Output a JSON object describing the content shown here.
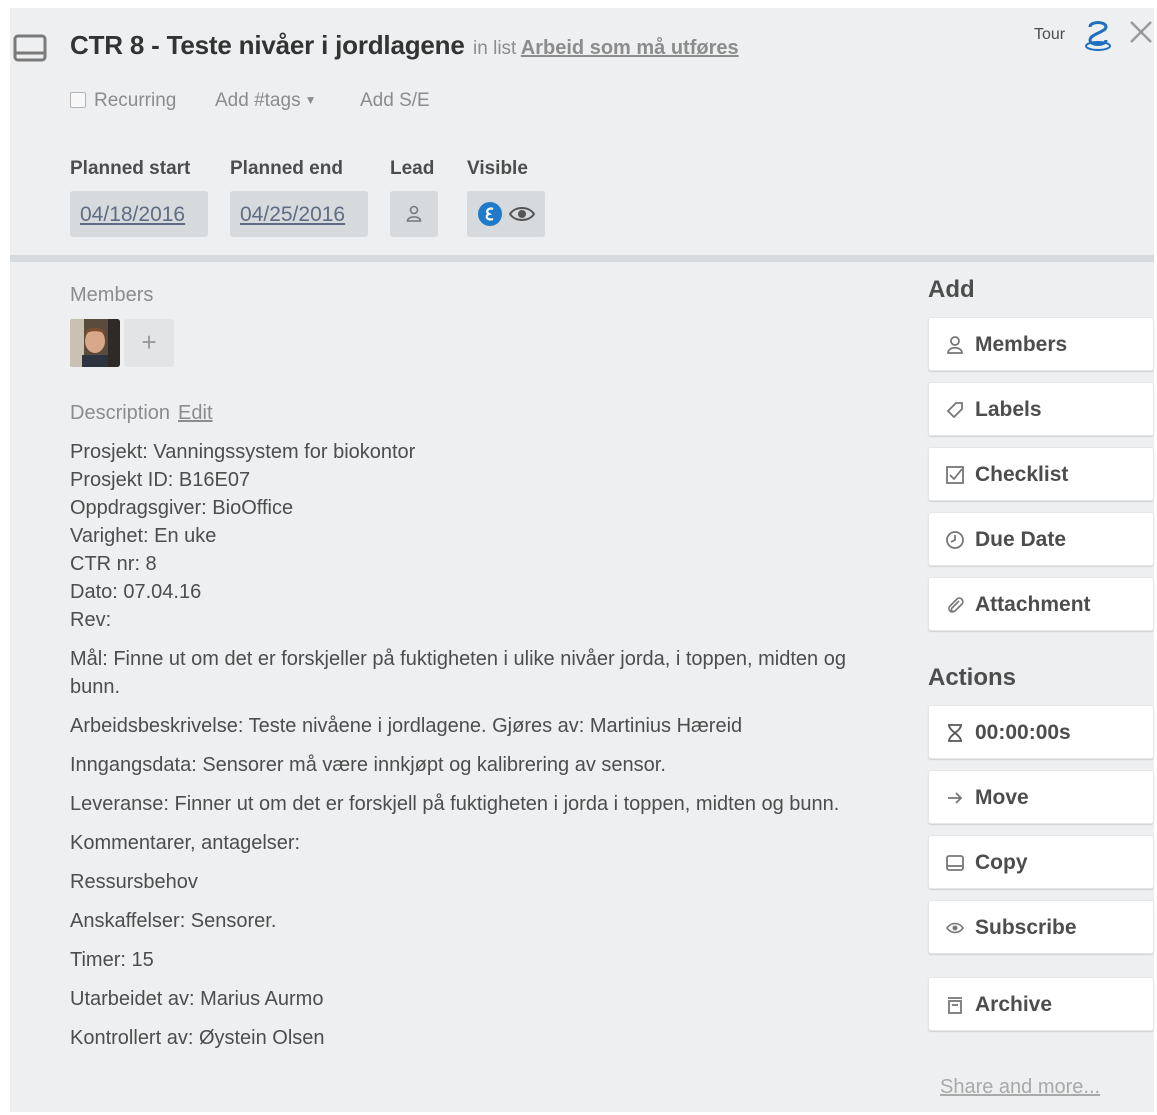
{
  "header": {
    "title": "CTR 8 - Teste nivåer i jordlagene",
    "in_list_prefix": "in list",
    "list_name": "Arbeid som må utføres",
    "tour_label": "Tour",
    "recurring_label": "Recurring",
    "add_tags_label": "Add #tags",
    "add_se_label": "Add S/E"
  },
  "fields": {
    "planned_start_label": "Planned start",
    "planned_start_value": "04/18/2016",
    "planned_end_label": "Planned end",
    "planned_end_value": "04/25/2016",
    "lead_label": "Lead",
    "visible_label": "Visible"
  },
  "members": {
    "label": "Members",
    "add_symbol": "+"
  },
  "description": {
    "label": "Description",
    "edit_label": "Edit",
    "lines": [
      "Prosjekt: Vanningssystem for biokontor",
      "Prosjekt ID: B16E07",
      "Oppdragsgiver: BioOffice",
      "Varighet: En uke",
      "CTR nr: 8",
      "Dato: 07.04.16",
      "Rev:"
    ],
    "paragraphs": [
      "Mål: Finne ut om det er forskjeller på fuktigheten i ulike nivåer jorda, i toppen, midten og bunn.",
      "Arbeidsbeskrivelse: Teste nivåene i jordlagene. Gjøres av: Martinius Hæreid",
      "Inngangsdata: Sensorer må være innkjøpt og kalibrering av sensor.",
      "Leveranse: Finner ut om det er forskjell på fuktigheten i jorda i toppen, midten og bunn.",
      "Kommentarer, antagelser:",
      "Ressursbehov",
      "Anskaffelser: Sensorer.",
      "Timer: 15",
      "Utarbeidet av: Marius Aurmo",
      "Kontrollert av: Øystein Olsen"
    ]
  },
  "sidebar": {
    "add_heading": "Add",
    "add_buttons": [
      {
        "label": "Members",
        "icon": "person-icon"
      },
      {
        "label": "Labels",
        "icon": "tag-icon"
      },
      {
        "label": "Checklist",
        "icon": "checkbox-icon"
      },
      {
        "label": "Due Date",
        "icon": "clock-icon"
      },
      {
        "label": "Attachment",
        "icon": "paperclip-icon"
      }
    ],
    "actions_heading": "Actions",
    "action_buttons": [
      {
        "label": "00:00:00s",
        "icon": "timer-icon"
      },
      {
        "label": "Move",
        "icon": "arrow-right-icon"
      },
      {
        "label": "Copy",
        "icon": "card-icon"
      },
      {
        "label": "Subscribe",
        "icon": "eye-icon"
      },
      {
        "label": "Archive",
        "icon": "archive-icon"
      }
    ],
    "share_label": "Share and more..."
  }
}
